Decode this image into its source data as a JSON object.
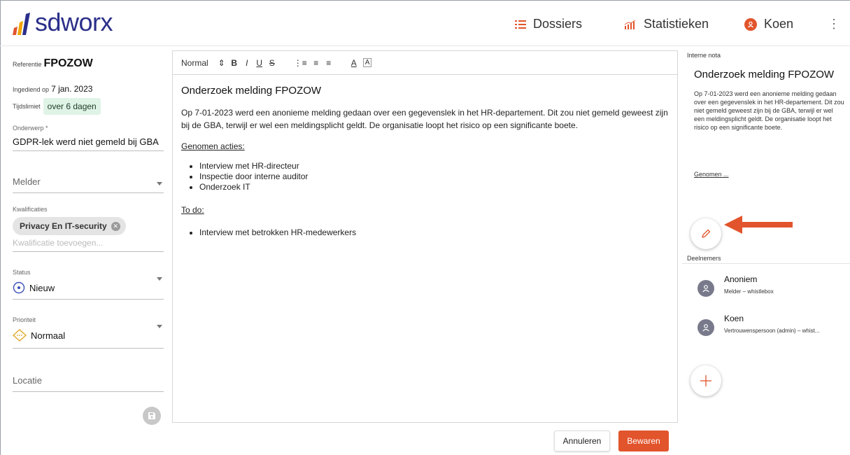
{
  "header": {
    "logo_text": "sdworx",
    "nav": [
      {
        "label": "Dossiers",
        "icon": "list-icon"
      },
      {
        "label": "Statistieken",
        "icon": "chart-icon"
      },
      {
        "label": "Koen",
        "icon": "user-avatar-icon"
      }
    ],
    "more_icon": "⋮"
  },
  "left": {
    "reference_label": "Referentie",
    "reference_value": "FPOZOW",
    "submitted_label": "Ingediend op",
    "submitted_value": "7 jan. 2023",
    "deadline_label": "Tijdslimiet",
    "deadline_value": "over 6 dagen",
    "subject_label": "Onderwerp *",
    "subject_value": "GDPR-lek werd niet gemeld bij GBA",
    "reporter_label": "Melder",
    "qualifications_label": "Kwalificaties",
    "qualification_tag": "Privacy En IT-security",
    "qualification_placeholder": "Kwalificatie toevoegen...",
    "status_label": "Status",
    "status_value": "Nieuw",
    "priority_label": "Prioriteit",
    "priority_value": "Normaal",
    "location_label": "Locatie"
  },
  "editor": {
    "toolbar": {
      "style": "Normal",
      "style_caret": "⇕",
      "bold": "B",
      "italic": "I",
      "underline": "U",
      "strike": "S",
      "ordered": "⋮≡",
      "bullet": "≡",
      "align": "≡",
      "color": "A",
      "bg": "A"
    },
    "title": "Onderzoek melding FPOZOW",
    "paragraph": "Op 7-01-2023 werd een anonieme melding gedaan over een gegevenslek in het HR-departement. Dit zou niet gemeld geweest zijn bij de GBA, terwijl er wel een meldingsplicht geldt. De organisatie loopt het risico op een significante boete.",
    "actions_heading": "Genomen acties:",
    "actions": [
      "Interview met HR-directeur",
      "Inspectie door interne auditor",
      "Onderzoek IT"
    ],
    "todo_heading": "To do:",
    "todos": [
      "Interview met betrokken HR-medewerkers"
    ]
  },
  "buttons": {
    "cancel": "Annuleren",
    "save": "Bewaren"
  },
  "right": {
    "note_label": "Interne nota",
    "note_title": "Onderzoek melding FPOZOW",
    "note_body": "Op 7-01-2023 werd een anonieme melding gedaan over een gegevenslek in het HR-departement. Dit zou niet gemeld geweest zijn bij de GBA, terwijl er wel een meldingsplicht geldt. De organisatie loopt het risico op een significante boete.",
    "note_more": "Genomen ...",
    "participants_label": "Deelnemers",
    "participants": [
      {
        "name": "Anoniem",
        "role": "Melder – whistlebox"
      },
      {
        "name": "Koen",
        "role": "Vertrouwenspersoon (admin) – whist..."
      }
    ]
  },
  "colors": {
    "accent": "#e2542b",
    "brand_blue": "#2b2f8a",
    "deadline_chip": "#dff3e6"
  }
}
